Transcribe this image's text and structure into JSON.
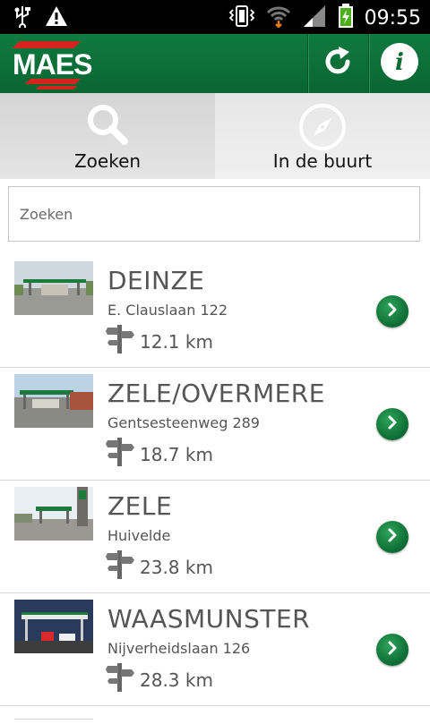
{
  "status_bar": {
    "time": "09:55",
    "icons": [
      "usb-icon",
      "warning-icon",
      "vibrate-icon",
      "wifi-icon",
      "signal-icon",
      "battery-charging-icon"
    ]
  },
  "app_bar": {
    "logo_text": "MAES",
    "brand_color": "#0a6b34",
    "actions": [
      "refresh-icon",
      "info-icon"
    ]
  },
  "tabs": [
    {
      "label": "Zoeken",
      "icon": "search-icon",
      "active": true
    },
    {
      "label": "In de buurt",
      "icon": "compass-icon",
      "active": false
    }
  ],
  "search": {
    "placeholder": "Zoeken",
    "value": ""
  },
  "stations": [
    {
      "name": "DEINZE",
      "address": "E. Clauslaan 122",
      "distance": "12.1 km"
    },
    {
      "name": "ZELE/OVERMERE",
      "address": "Gentsesteenweg 289",
      "distance": "18.7 km"
    },
    {
      "name": "ZELE",
      "address": "Huivelde",
      "distance": "23.8 km"
    },
    {
      "name": "WAASMUNSTER",
      "address": "Nijverheidslaan 126",
      "distance": "28.3 km"
    }
  ]
}
